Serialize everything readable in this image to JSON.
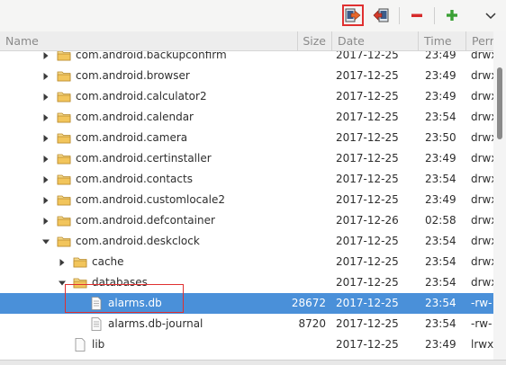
{
  "header": {
    "name": "Name",
    "size": "Size",
    "date": "Date",
    "time": "Time",
    "perm": "Perm"
  },
  "toolbar": {
    "buttons": [
      {
        "icon": "pull-file-icon",
        "highlighted": true
      },
      {
        "icon": "push-file-icon",
        "highlighted": false
      },
      {
        "icon": "delete-icon",
        "color": "#d62b2b"
      },
      {
        "icon": "add-icon",
        "color": "#3aa035"
      },
      {
        "icon": "view-menu-chevron-icon"
      }
    ]
  },
  "rows": [
    {
      "name": "com.android.backupconfirm",
      "size": "",
      "date": "2017-12-25",
      "time": "23:49",
      "perm": "drwx",
      "type": "folder",
      "expand": "collapsed"
    },
    {
      "name": "com.android.browser",
      "size": "",
      "date": "2017-12-25",
      "time": "23:49",
      "perm": "drwx",
      "type": "folder",
      "expand": "collapsed"
    },
    {
      "name": "com.android.calculator2",
      "size": "",
      "date": "2017-12-25",
      "time": "23:49",
      "perm": "drwx",
      "type": "folder",
      "expand": "collapsed"
    },
    {
      "name": "com.android.calendar",
      "size": "",
      "date": "2017-12-25",
      "time": "23:54",
      "perm": "drwx",
      "type": "folder",
      "expand": "collapsed"
    },
    {
      "name": "com.android.camera",
      "size": "",
      "date": "2017-12-25",
      "time": "23:50",
      "perm": "drwx",
      "type": "folder",
      "expand": "collapsed"
    },
    {
      "name": "com.android.certinstaller",
      "size": "",
      "date": "2017-12-25",
      "time": "23:49",
      "perm": "drwx",
      "type": "folder",
      "expand": "collapsed"
    },
    {
      "name": "com.android.contacts",
      "size": "",
      "date": "2017-12-25",
      "time": "23:54",
      "perm": "drwx",
      "type": "folder",
      "expand": "collapsed"
    },
    {
      "name": "com.android.customlocale2",
      "size": "",
      "date": "2017-12-25",
      "time": "23:49",
      "perm": "drwx",
      "type": "folder",
      "expand": "collapsed"
    },
    {
      "name": "com.android.defcontainer",
      "size": "",
      "date": "2017-12-26",
      "time": "02:58",
      "perm": "drwx",
      "type": "folder",
      "expand": "collapsed"
    },
    {
      "name": "com.android.deskclock",
      "size": "",
      "date": "2017-12-25",
      "time": "23:54",
      "perm": "drwx",
      "type": "folder",
      "expand": "expanded"
    },
    {
      "name": "cache",
      "size": "",
      "date": "2017-12-25",
      "time": "23:54",
      "perm": "drwx",
      "type": "folder",
      "expand": "collapsed"
    },
    {
      "name": "databases",
      "size": "",
      "date": "2017-12-25",
      "time": "23:54",
      "perm": "drwx",
      "type": "folder",
      "expand": "expanded"
    },
    {
      "name": "alarms.db",
      "size": "28672",
      "date": "2017-12-25",
      "time": "23:54",
      "perm": "-rw-",
      "type": "file",
      "expand": "none",
      "selected": true
    },
    {
      "name": "alarms.db-journal",
      "size": "8720",
      "date": "2017-12-25",
      "time": "23:54",
      "perm": "-rw-",
      "type": "file",
      "expand": "none"
    },
    {
      "name": "lib",
      "size": "",
      "date": "2017-12-25",
      "time": "23:49",
      "perm": "lrwx",
      "type": "link",
      "expand": "none"
    }
  ],
  "colors": {
    "selection": "#4a90d9",
    "folder": "#f2c55c",
    "highlight_box": "#e03030"
  }
}
